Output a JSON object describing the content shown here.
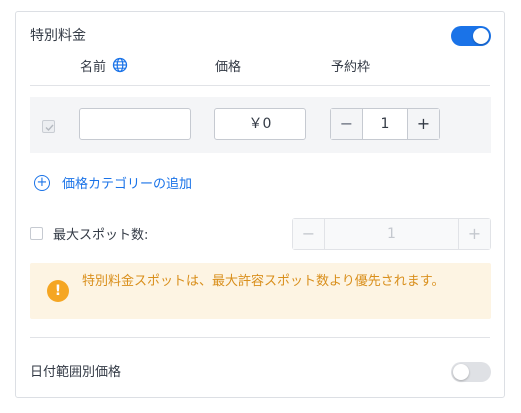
{
  "special_pricing": {
    "title": "特別料金",
    "toggle_on": true
  },
  "columns": {
    "name": "名前",
    "price": "価格",
    "quota": "予約枠"
  },
  "row": {
    "name_value": "",
    "price_value": "￥0",
    "quota_minus": "−",
    "quota_value": "1",
    "quota_plus": "+"
  },
  "add_category": {
    "icon": "+",
    "label": "価格カテゴリーの追加"
  },
  "max_spots": {
    "label": "最大スポット数:",
    "minus": "−",
    "value": "1",
    "plus": "+"
  },
  "notice": {
    "icon": "!",
    "text": "特別料金スポットは、最大許容スポット数より優先されます。"
  },
  "date_range_pricing": {
    "label": "日付範囲別価格",
    "toggle_on": false
  },
  "colors": {
    "accent": "#1a73e8",
    "warning": "#f5a623",
    "warning_text": "#d98f1c",
    "warning_bg": "#fdf4e3"
  }
}
